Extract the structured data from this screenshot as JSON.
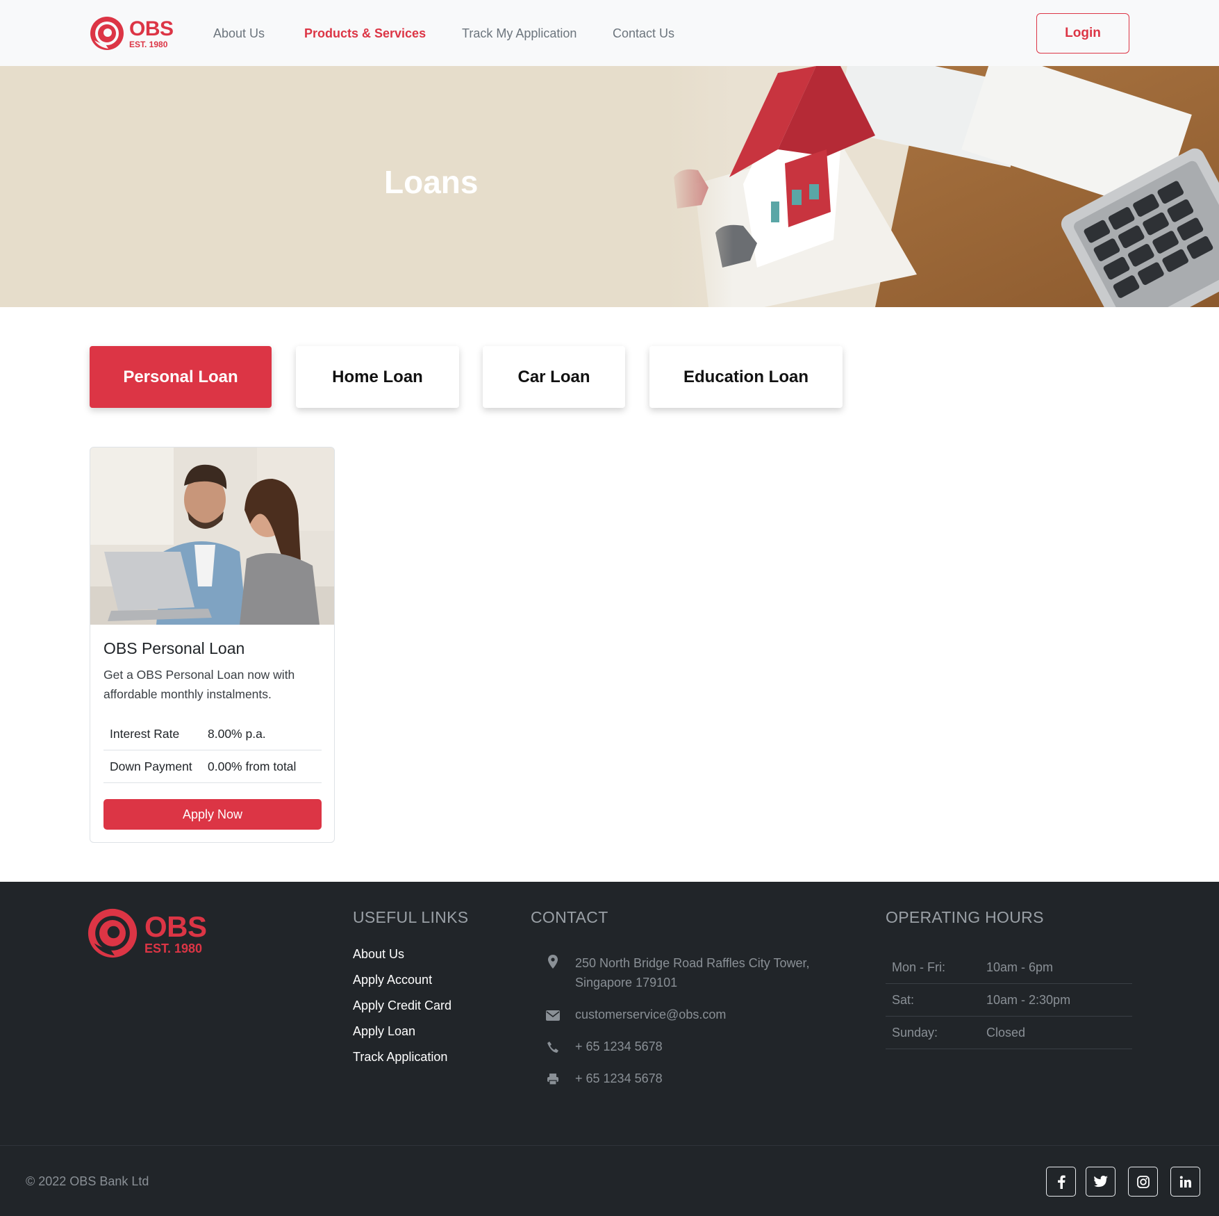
{
  "brand": {
    "name": "OBS",
    "est": "EST. 1980",
    "accent_color": "#dc3545"
  },
  "nav": {
    "links": [
      {
        "label": "About Us"
      },
      {
        "label": "Products & Services"
      },
      {
        "label": "Track My Application"
      },
      {
        "label": "Contact Us"
      }
    ],
    "active": "Products & Services",
    "login_label": "Login"
  },
  "hero": {
    "title": "Loans"
  },
  "tabs": [
    {
      "label": "Personal Loan"
    },
    {
      "label": "Home Loan"
    },
    {
      "label": "Car Loan"
    },
    {
      "label": "Education Loan"
    }
  ],
  "active_tab": "Personal Loan",
  "card": {
    "title": "OBS Personal Loan",
    "description": "Get a OBS Personal Loan now with affordable monthly instalments.",
    "rows": [
      {
        "label": "Interest Rate",
        "value": "8.00% p.a."
      },
      {
        "label": "Down Payment",
        "value": "0.00% from total"
      }
    ],
    "button_label": "Apply Now"
  },
  "footer": {
    "useful_links_heading": "USEFUL LINKS",
    "useful_links": [
      {
        "label": "About Us"
      },
      {
        "label": "Apply Account"
      },
      {
        "label": "Apply Credit Card"
      },
      {
        "label": "Apply Loan"
      },
      {
        "label": "Track Application"
      }
    ],
    "contact_heading": "CONTACT",
    "contact": [
      {
        "icon": "map-marker-icon",
        "text": "250 North Bridge Road Raffles City Tower, Singapore 179101"
      },
      {
        "icon": "envelope-icon",
        "text": "customerservice@obs.com"
      },
      {
        "icon": "phone-icon",
        "text": "+ 65 1234 5678"
      },
      {
        "icon": "printer-icon",
        "text": "+ 65 1234 5678"
      }
    ],
    "hours_heading": "OPERATING HOURS",
    "hours": [
      {
        "day": "Mon - Fri:",
        "time": "10am - 6pm"
      },
      {
        "day": "Sat:",
        "time": "10am - 2:30pm"
      },
      {
        "day": "Sunday:",
        "time": "Closed"
      }
    ],
    "copyright": "© 2022 OBS Bank Ltd",
    "social": [
      {
        "icon": "facebook-icon"
      },
      {
        "icon": "twitter-icon"
      },
      {
        "icon": "instagram-icon"
      },
      {
        "icon": "linkedin-icon"
      }
    ]
  }
}
